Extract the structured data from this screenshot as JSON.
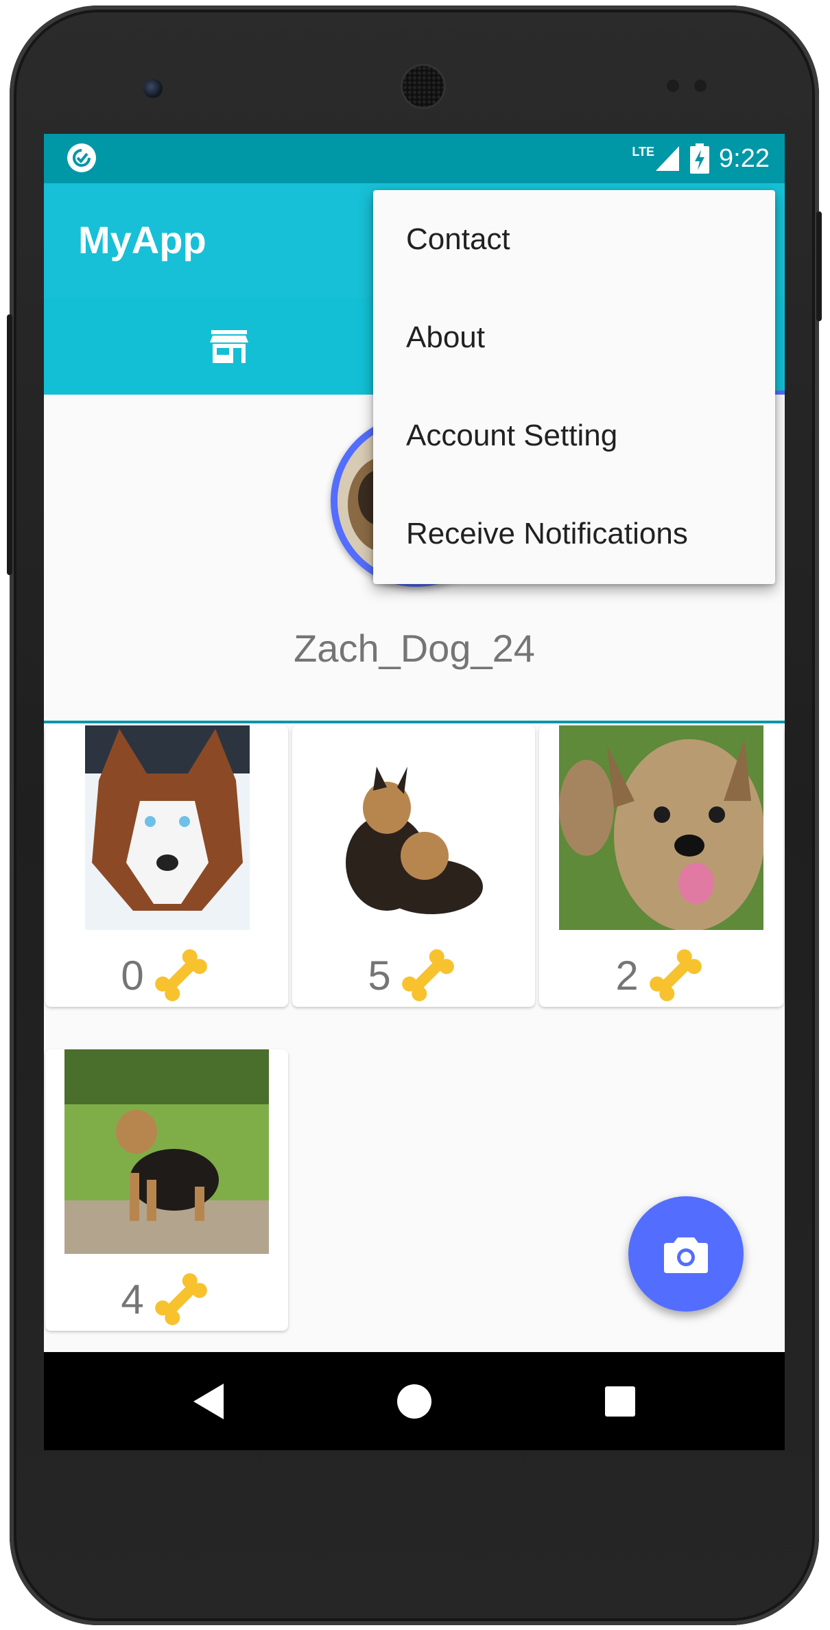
{
  "app": {
    "title": "MyApp"
  },
  "status_bar": {
    "time": "9:22",
    "network": "LTE"
  },
  "tabs": [
    {
      "icon": "store-icon",
      "selected": false
    },
    {
      "icon": "unknown-tab-icon",
      "selected": true
    }
  ],
  "profile": {
    "username": "Zach_Dog_24"
  },
  "posts": [
    {
      "image": "husky-photo",
      "count": "0",
      "icon": "bone-icon"
    },
    {
      "image": "two-yorkie-puppies-photo",
      "count": "5",
      "icon": "bone-icon"
    },
    {
      "image": "yorkie-closeup-photo",
      "count": "2",
      "icon": "bone-icon"
    },
    {
      "image": "yorkie-on-grass-photo",
      "count": "4",
      "icon": "bone-icon"
    }
  ],
  "fab": {
    "icon": "camera-icon"
  },
  "overflow_menu": {
    "items": [
      "Contact",
      "About",
      "Account Setting",
      "Receive Notifications"
    ]
  },
  "colors": {
    "primary": "#17c0d6",
    "primary_dark": "#0097a7",
    "accent": "#536dfe",
    "bone": "#f7c22d"
  }
}
